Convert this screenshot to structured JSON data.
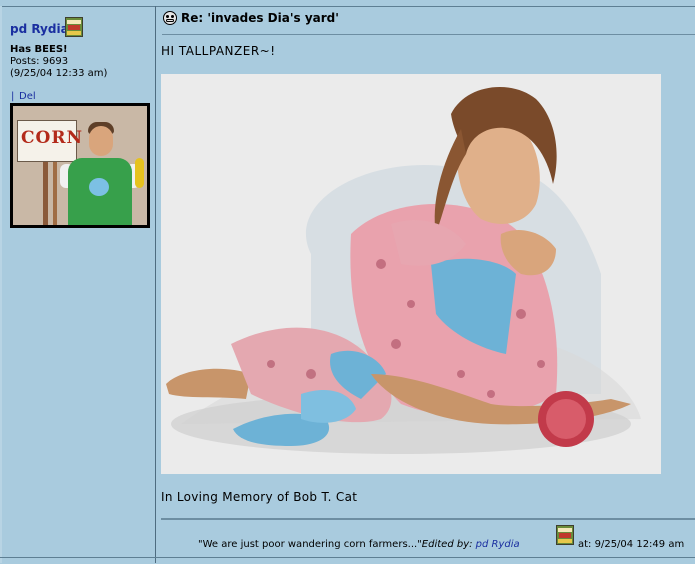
{
  "author": {
    "name": "pd Rydia",
    "title": "Has BEES!",
    "posts": "Posts: 9693",
    "joined": "(9/25/04 12:33 am)",
    "separator": "|",
    "delete_link": "Del",
    "avatar_sign_text": "CORN"
  },
  "post": {
    "subject": "Re: 'invades Dia's yard'",
    "greeting": "HI TALLPANZER~!",
    "signature": "In Loving Memory of Bob T. Cat",
    "footer_quote": "\"We are just poor wandering corn farmers...\"",
    "edited_by_label": "Edited by:",
    "edited_by_name": "pd Rydia",
    "edited_at": "at: 9/25/04 12:49 am"
  },
  "icons": {
    "badge": "profile-badge-icon",
    "post": "post-face-icon"
  },
  "colors": {
    "background": "#a9cbde",
    "link": "#1a2fa0",
    "rule": "#6d8ea2"
  }
}
